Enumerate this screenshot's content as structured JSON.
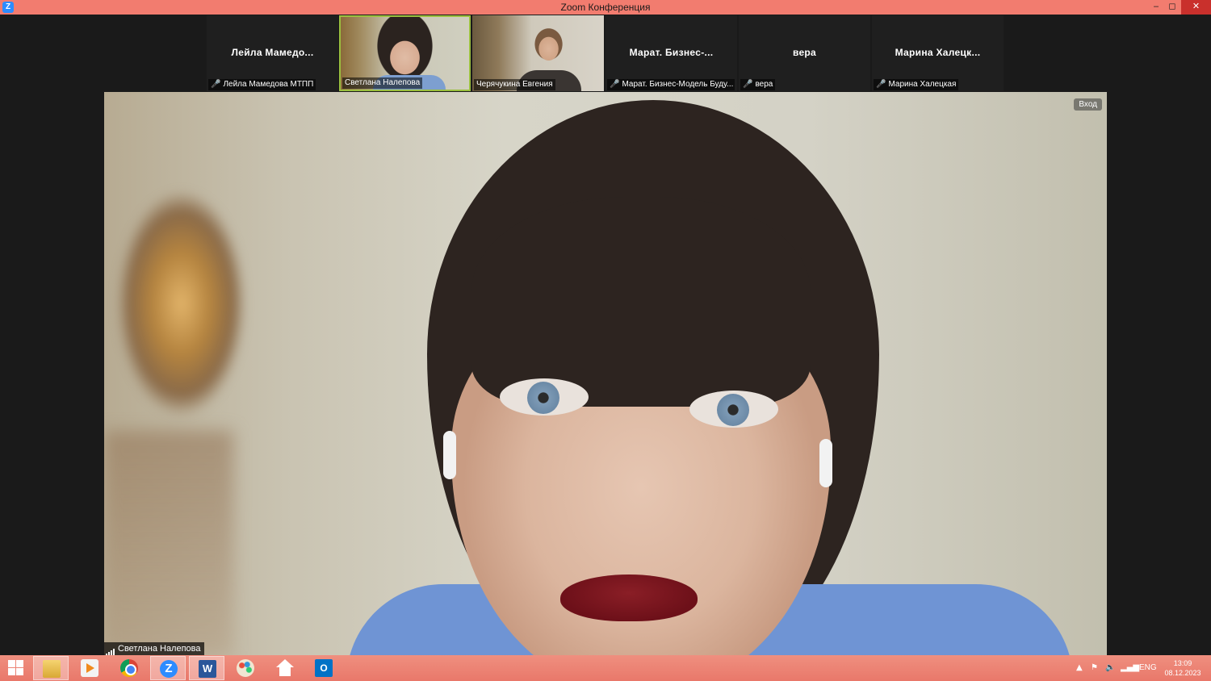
{
  "window": {
    "title": "Zoom Конференция",
    "app_icon": "Z",
    "controls": {
      "minimize": "‒",
      "maximize": "◻",
      "close": "✕"
    }
  },
  "participants": [
    {
      "big_name": "Лейла  Мамедо...",
      "label": "Лейла Мамедова МТПП",
      "muted": true,
      "video": false
    },
    {
      "big_name": "",
      "label": "Светлана Налепова",
      "muted": false,
      "video": true,
      "active": true
    },
    {
      "big_name": "",
      "label": "Черячукина Евгения",
      "muted": false,
      "video": true
    },
    {
      "big_name": "Марат.  Бизнес-...",
      "label": "Марат. Бизнес-Модель Буду...",
      "muted": true,
      "video": false
    },
    {
      "big_name": "вера",
      "label": "вера",
      "muted": true,
      "video": false
    },
    {
      "big_name": "Марина  Халецк...",
      "label": "Марина Халецкая",
      "muted": true,
      "video": false
    }
  ],
  "main_video": {
    "speaker_label": "Светлана Налепова",
    "enter_button": "Вход"
  },
  "taskbar": {
    "items": [
      "start-icon",
      "file-explorer-icon",
      "media-player-icon",
      "chrome-icon",
      "zoom-icon",
      "word-icon",
      "paint-icon",
      "home-icon",
      "outlook-icon"
    ],
    "zoom_letter": "Z",
    "word_letter": "W",
    "outlook_letter": "O",
    "tray": {
      "up": "▲",
      "flag": "⚑",
      "volume": "🔈",
      "network": "▂▄▆",
      "language": "ENG"
    },
    "time": "13:09",
    "date": "08.12.2023"
  },
  "colors": {
    "titlebar": "#f27c6f",
    "taskbar": "#ec8575",
    "active_border": "#9bc03f",
    "mute": "#e0453a"
  }
}
